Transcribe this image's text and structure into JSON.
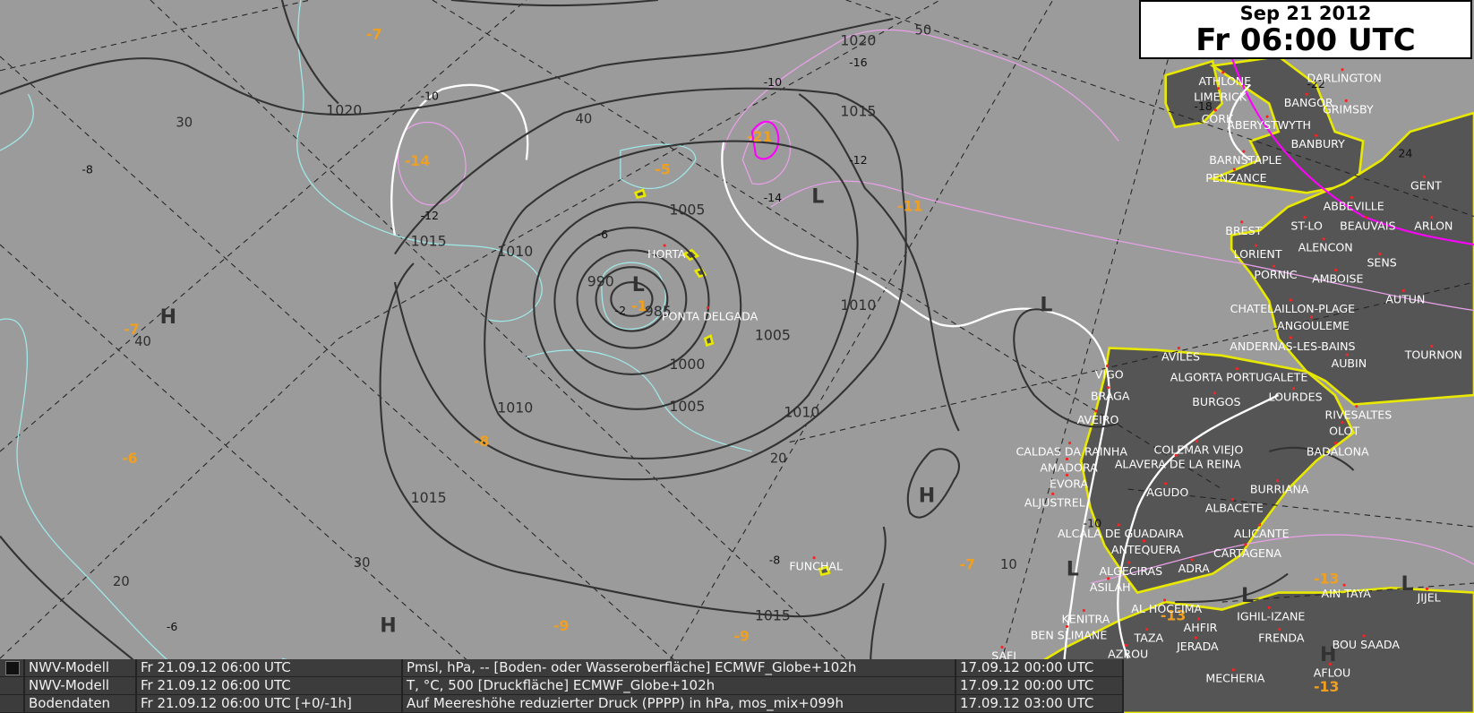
{
  "header": {
    "date": "Sep 21 2012",
    "time": "Fr 06:00 UTC"
  },
  "legend": [
    {
      "source": "NWV-Modell",
      "valid": "Fr 21.09.12 06:00 UTC",
      "field": "Pmsl, hPa, -- [Boden- oder Wasseroberfläche] ECMWF_Globe+102h",
      "run": "17.09.12 00:00 UTC"
    },
    {
      "source": "NWV-Modell",
      "valid": "Fr 21.09.12 06:00 UTC",
      "field": "T, °C, 500 [Druckfläche] ECMWF_Globe+102h",
      "run": "17.09.12 00:00 UTC"
    },
    {
      "source": "Bodendaten",
      "valid": "Fr 21.09.12 06:00 UTC [+0/-1h]",
      "field": "Auf Meereshöhe reduzierter Druck (PPPP) in hPa,  mos_mix+099h",
      "run": "17.09.12 03:00 UTC"
    }
  ],
  "pressure_labels": [
    "1020",
    "1020",
    "1015",
    "1015",
    "1010",
    "1005",
    "990",
    "985",
    "1000",
    "1005",
    "1005",
    "1010",
    "1010",
    "1010",
    "1015",
    "1015"
  ],
  "temp_labels": [
    "-10",
    "-12",
    "-8",
    "-6",
    "-2",
    "-16",
    "-10",
    "-12",
    "-14",
    "-8",
    "-6",
    "-22",
    "24",
    "-18",
    "-10"
  ],
  "temp_station_labels": [
    "-7",
    "-14",
    "-5",
    "-21",
    "-11",
    "-7",
    "-1",
    "-6",
    "-8",
    "-9",
    "-9",
    "-7",
    "-13",
    "-13",
    "-13"
  ],
  "grid_labels": [
    "50",
    "40",
    "30",
    "40",
    "20",
    "30",
    "20",
    "10"
  ],
  "centers": [
    "H",
    "H",
    "H",
    "H",
    "L",
    "L",
    "L",
    "L",
    "L",
    "L"
  ],
  "cities": [
    "HORTA",
    "PONTA DELGADA",
    "FUNCHAL",
    "ATHLONE",
    "LIMERICK",
    "CORK",
    "BANGOR",
    "DARLINGTON",
    "GRIMSBY",
    "ABERYSTWYTH",
    "BANBURY",
    "BARNSTAPLE",
    "PENZANCE",
    "GENT",
    "ABBEVILLE",
    "ST-LO",
    "BEAUVAIS",
    "ARLON",
    "BREST",
    "LORIENT",
    "ALENCON",
    "SENS",
    "PORNIC",
    "AMBOISE",
    "AUTUN",
    "CHATELAILLON-PLAGE",
    "ANGOULEME",
    "ANDERNAS-LES-BAINS",
    "AUBIN",
    "TOURNON",
    "AVILES",
    "VIGO",
    "ALGORTA PORTUGALETE",
    "BRAGA",
    "BURGOS",
    "LOURDES",
    "RIVESALTES",
    "OLOT",
    "AVEIRO",
    "CALDAS DA RAINHA",
    "COLEMAR VIEJO",
    "ALAVERA DE LA REINA",
    "BADALONA",
    "AMADORA",
    "EVORA",
    "AGUDO",
    "BURRIANA",
    "ALJUSTREL",
    "ALBACETE",
    "ALCALA DE GUADAIRA",
    "ALICANTE",
    "ANTEQUERA",
    "CARTAGENA",
    "ALGECIRAS",
    "ADRA",
    "ASILAH",
    "AL HOCEIMA",
    "AIN TAYA",
    "IGHIL-IZANE",
    "JIJEL",
    "KENITRA",
    "AHFIR",
    "BEN SLIMANE",
    "TAZA",
    "JERADA",
    "FRENDA",
    "BOU SAADA",
    "AZROU",
    "MECHERIA",
    "AFLOU",
    "SAFI"
  ],
  "colors": {
    "isobar": "#333333",
    "isotherm_cyan": "#a0e8e8",
    "isotherm_pink": "#e8a0e8",
    "zero_line": "#ffffff",
    "coast": "#e8e800",
    "temp_label": "#f0a020"
  }
}
